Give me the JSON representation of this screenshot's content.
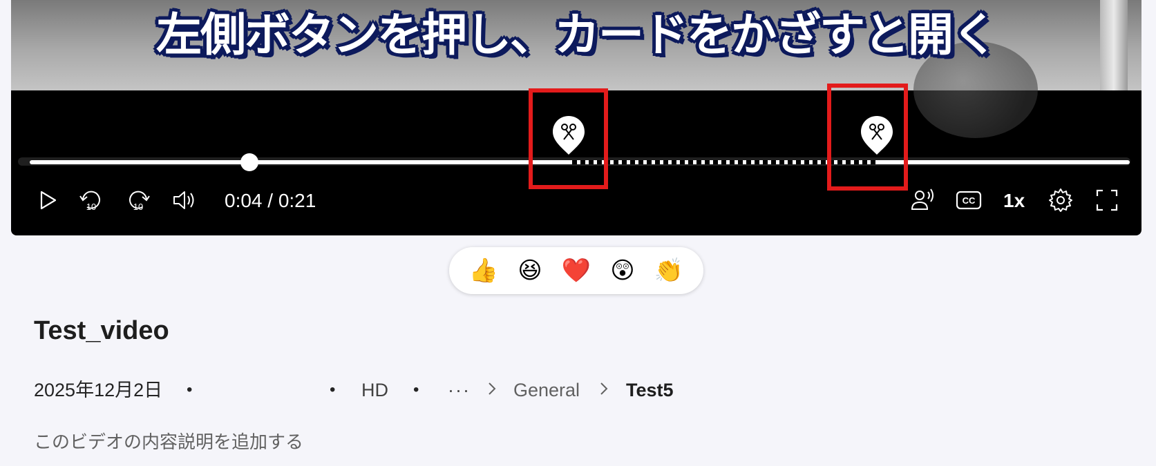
{
  "video": {
    "caption": "左側ボタンを押し、カードをかざすと開く",
    "progress": 0.2,
    "clip_start": 0.49,
    "clip_end": 0.77
  },
  "controls": {
    "time": "0:04 / 0:21",
    "speed": "1x",
    "rewind_label": "10",
    "forward_label": "10",
    "cc_label": "CC"
  },
  "reactions": [
    "👍",
    "😆",
    "❤️",
    "😲",
    "👏"
  ],
  "details": {
    "title": "Test_video",
    "date": "2025年12月2日",
    "quality": "HD",
    "more": "···",
    "breadcrumb": [
      "General",
      "Test5"
    ],
    "description_placeholder": "このビデオの内容説明を追加する"
  },
  "colors": {
    "highlight": "#e31b1b",
    "caption_outline": "#0d1a5c"
  }
}
